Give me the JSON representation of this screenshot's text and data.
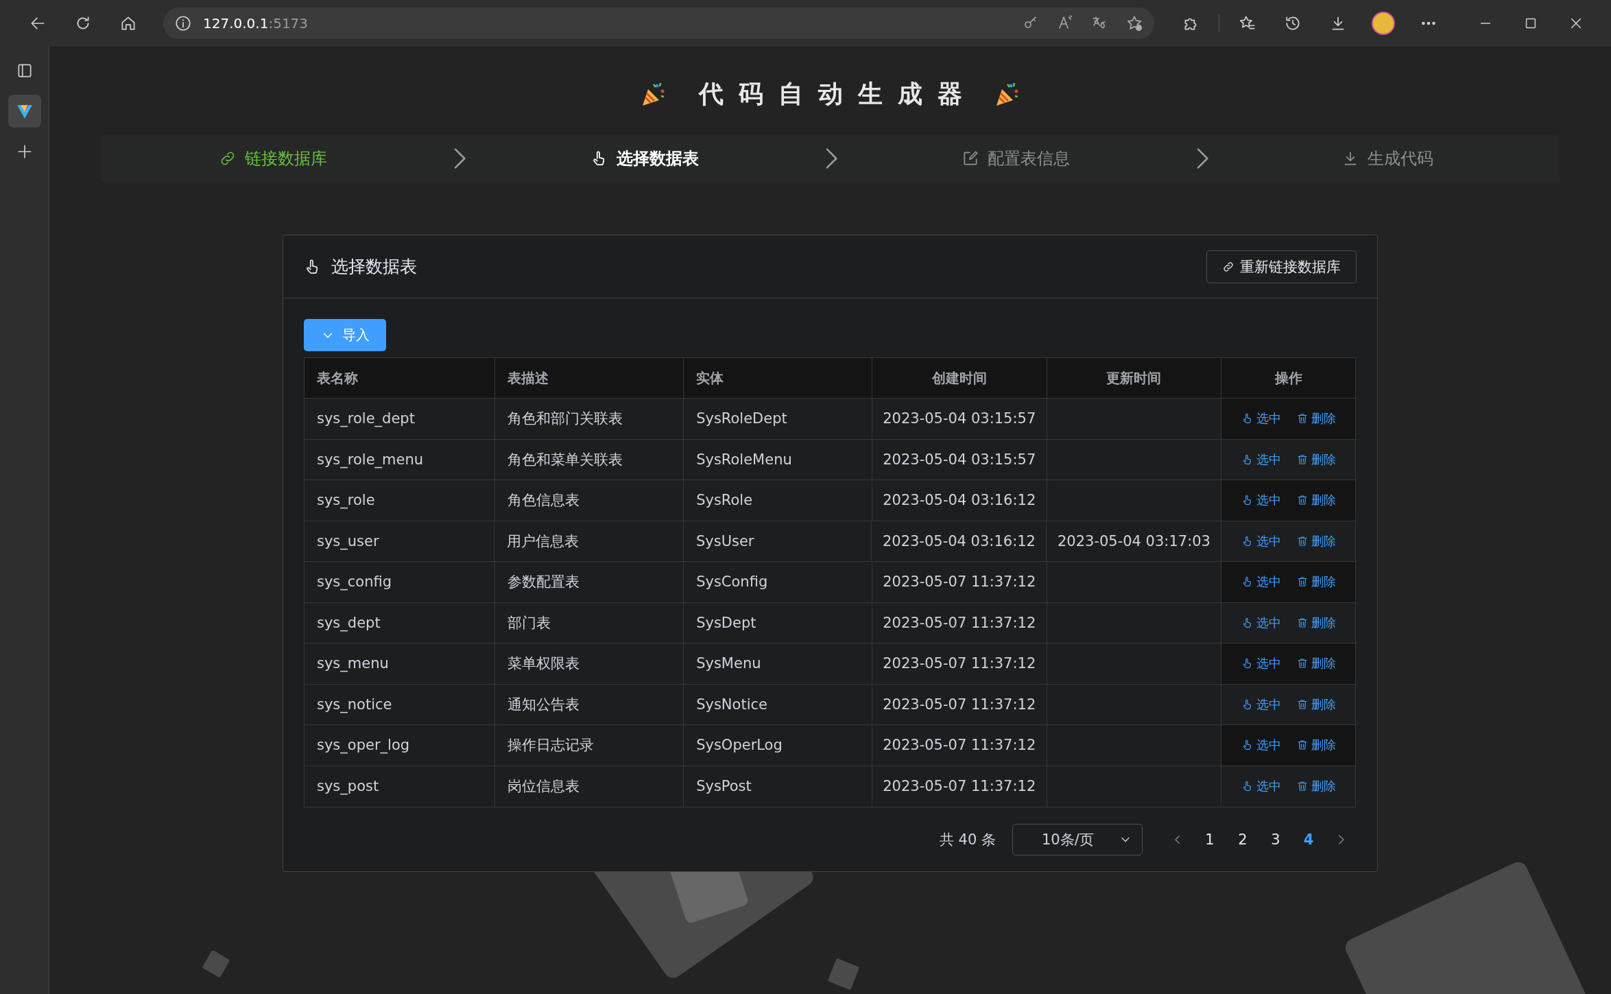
{
  "browser": {
    "address_host": "127.0.0.1",
    "address_port": ":5173"
  },
  "title": "代码自动生成器",
  "steps": [
    {
      "label": "链接数据库",
      "done": true,
      "selected": false
    },
    {
      "label": "选择数据表",
      "done": false,
      "selected": true
    },
    {
      "label": "配置表信息",
      "done": false,
      "selected": false
    },
    {
      "label": "生成代码",
      "done": false,
      "selected": false
    }
  ],
  "card": {
    "title": "选择数据表",
    "reconnect_button": "重新链接数据库",
    "import_button": "导入",
    "columns": [
      "表名称",
      "表描述",
      "实体",
      "创建时间",
      "更新时间",
      "操作"
    ],
    "rows": [
      {
        "name": "sys_role_dept",
        "description": "角色和部门关联表",
        "entity": "SysRoleDept",
        "created": "2023-05-04 03:15:57",
        "select": "选中",
        "delete": "删除"
      },
      {
        "name": "sys_role_menu",
        "description": "角色和菜单关联表",
        "entity": "SysRoleMenu",
        "created": "2023-05-04 03:15:57",
        "select": "选中",
        "delete": "删除"
      },
      {
        "name": "sys_role",
        "description": "角色信息表",
        "entity": "SysRole",
        "created": "2023-05-04 03:16:12",
        "select": "选中",
        "delete": "删除"
      },
      {
        "name": "sys_user",
        "description": "用户信息表",
        "entity": "SysUser",
        "created": "2023-05-04 03:16:12",
        "updated": "2023-05-04 03:17:03",
        "select": "选中",
        "delete": "删除"
      },
      {
        "name": "sys_config",
        "description": "参数配置表",
        "entity": "SysConfig",
        "created": "2023-05-07 11:37:12",
        "select": "选中",
        "delete": "删除"
      },
      {
        "name": "sys_dept",
        "description": "部门表",
        "entity": "SysDept",
        "created": "2023-05-07 11:37:12",
        "select": "选中",
        "delete": "删除"
      },
      {
        "name": "sys_menu",
        "description": "菜单权限表",
        "entity": "SysMenu",
        "created": "2023-05-07 11:37:12",
        "select": "选中",
        "delete": "删除"
      },
      {
        "name": "sys_notice",
        "description": "通知公告表",
        "entity": "SysNotice",
        "created": "2023-05-07 11:37:12",
        "select": "选中",
        "delete": "删除"
      },
      {
        "name": "sys_oper_log",
        "description": "操作日志记录",
        "entity": "SysOperLog",
        "created": "2023-05-07 11:37:12",
        "select": "选中",
        "delete": "删除"
      },
      {
        "name": "sys_post",
        "description": "岗位信息表",
        "entity": "SysPost",
        "created": "2023-05-07 11:37:12",
        "select": "选中",
        "delete": "删除"
      }
    ],
    "pagination": {
      "total": "共 40 条",
      "page_size": "10条/页",
      "pages": [
        {
          "label": "1",
          "selected": false
        },
        {
          "label": "2",
          "selected": false
        },
        {
          "label": "3",
          "selected": false
        },
        {
          "label": "4",
          "selected": true
        }
      ]
    }
  }
}
